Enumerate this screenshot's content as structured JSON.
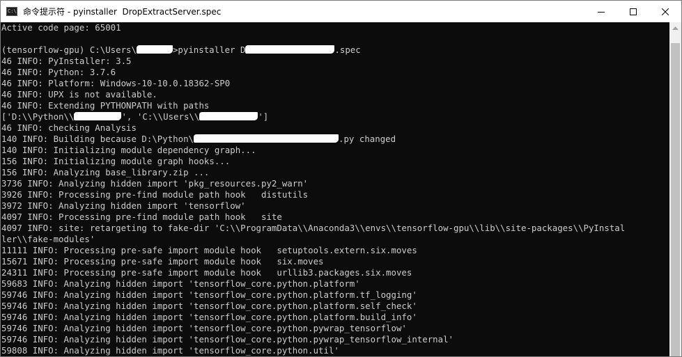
{
  "window": {
    "title": "命令提示符 - pyinstaller  DropExtractServer.spec",
    "icons": {
      "app": "cmd-icon",
      "minimize": "minimize-icon",
      "maximize": "maximize-icon",
      "close": "close-icon"
    }
  },
  "console": {
    "lines": [
      [
        "Active code page: 65001"
      ],
      [
        ""
      ],
      [
        "(tensorflow-gpu) C:\\Users\\",
        {
          "redact": "w"
        },
        ">pyinstaller D",
        {
          "redact": "w"
        },
        ".spec"
      ],
      [
        "46 INFO: PyInstaller: 3.5"
      ],
      [
        "46 INFO: Python: 3.7.6"
      ],
      [
        "46 INFO: Platform: Windows-10-10.0.18362-SP0"
      ],
      [
        "46 INFO: UPX is not available."
      ],
      [
        "46 INFO: Extending PYTHONPATH with paths"
      ],
      [
        "['D:\\\\Python\\\\",
        {
          "redact": "w"
        },
        "', 'C:\\\\Users\\\\",
        {
          "redact": "w"
        },
        "']"
      ],
      [
        "46 INFO: checking Analysis"
      ],
      [
        "140 INFO: Building because D:\\Python\\",
        {
          "redact": "w"
        },
        ".py changed"
      ],
      [
        "140 INFO: Initializing module dependency graph..."
      ],
      [
        "156 INFO: Initializing module graph hooks..."
      ],
      [
        "156 INFO: Analyzing base_library.zip ..."
      ],
      [
        "3736 INFO: Analyzing hidden import 'pkg_resources.py2_warn'"
      ],
      [
        "3926 INFO: Processing pre-find module path hook   distutils"
      ],
      [
        "3972 INFO: Analyzing hidden import 'tensorflow'"
      ],
      [
        "4097 INFO: Processing pre-find module path hook   site"
      ],
      [
        "4097 INFO: site: retargeting to fake-dir 'C:\\\\ProgramData\\\\Anaconda3\\\\envs\\\\tensorflow-gpu\\\\lib\\\\site-packages\\\\PyInstal"
      ],
      [
        "ler\\\\fake-modules'"
      ],
      [
        "11111 INFO: Processing pre-safe import module hook   setuptools.extern.six.moves"
      ],
      [
        "15671 INFO: Processing pre-safe import module hook   six.moves"
      ],
      [
        "24311 INFO: Processing pre-safe import module hook   urllib3.packages.six.moves"
      ],
      [
        "59683 INFO: Analyzing hidden import 'tensorflow_core.python.platform'"
      ],
      [
        "59746 INFO: Analyzing hidden import 'tensorflow_core.python.platform.tf_logging'"
      ],
      [
        "59746 INFO: Analyzing hidden import 'tensorflow_core.python.platform.self_check'"
      ],
      [
        "59746 INFO: Analyzing hidden import 'tensorflow_core.python.platform.build_info'"
      ],
      [
        "59746 INFO: Analyzing hidden import 'tensorflow_core.python.pywrap_tensorflow'"
      ],
      [
        "59746 INFO: Analyzing hidden import 'tensorflow_core.python.pywrap_tensorflow_internal'"
      ],
      [
        "59808 INFO: Analyzing hidden import 'tensorflow_core.python.util'"
      ]
    ]
  },
  "scrollbar": {
    "up_icon": "scroll-up-arrow-icon",
    "position": 1.0
  },
  "colors": {
    "console_bg": "#0c0c0c",
    "console_fg": "#cccccc",
    "titlebar_bg": "#ffffff"
  }
}
